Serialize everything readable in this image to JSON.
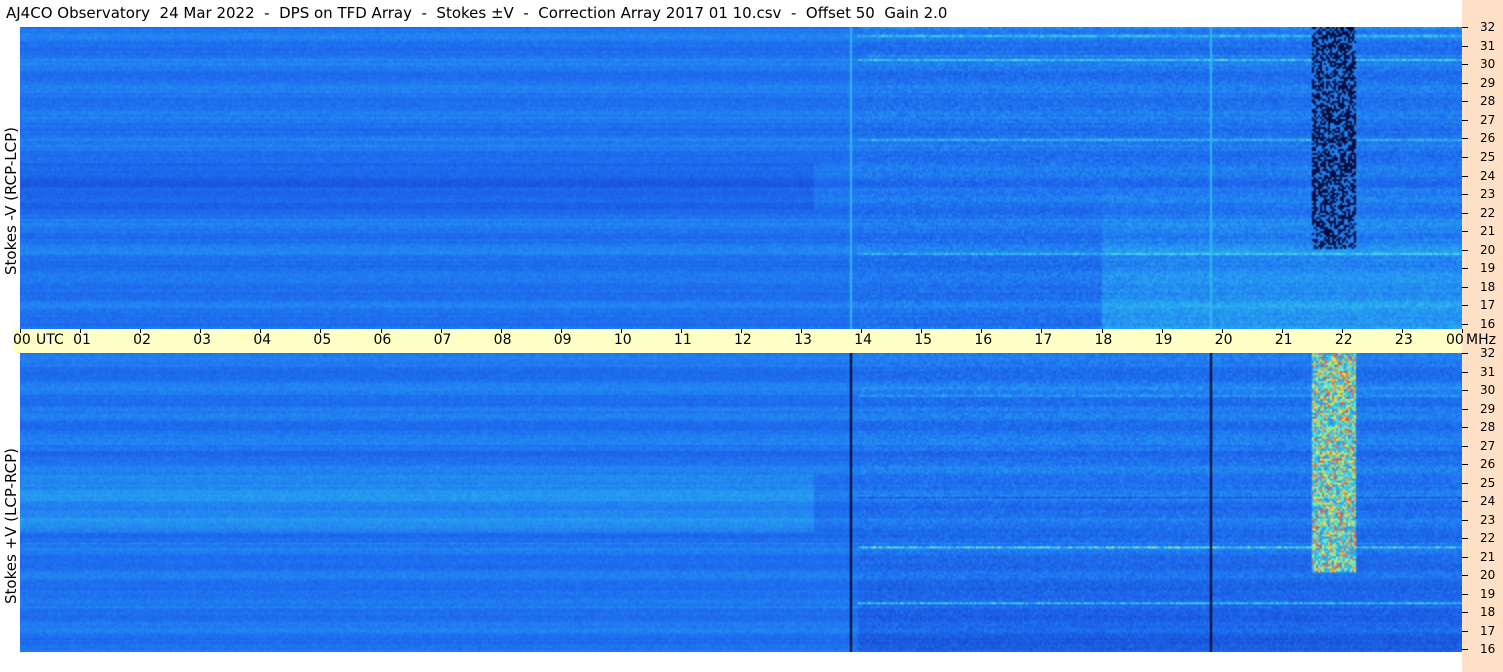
{
  "header": {
    "title": "AJ4CO Observatory  24 Mar 2022  -  DPS on TFD Array  -  Stokes ±V  -  Correction Array 2017 01 10.csv  -  Offset 50  Gain 2.0"
  },
  "panels": {
    "top_ylabel": "Stokes -V (RCP-LCP)",
    "bottom_ylabel": "Stokes +V (LCP-RCP)"
  },
  "colors": {
    "background_blue": "#1e64e6",
    "time_bar": "#ffffc8",
    "freq_bar": "#ffe1c8"
  },
  "chart_data": {
    "type": "heatmap",
    "x_axis": {
      "unit": "UTC",
      "tick_labels": [
        "00",
        "01",
        "02",
        "03",
        "04",
        "05",
        "06",
        "07",
        "08",
        "09",
        "10",
        "11",
        "12",
        "13",
        "14",
        "15",
        "16",
        "17",
        "18",
        "19",
        "20",
        "21",
        "22",
        "23",
        "00"
      ],
      "unit_label": "UTC",
      "range_hours": [
        0,
        24
      ]
    },
    "y_axis": {
      "unit": "MHz",
      "tick_labels": [
        "32",
        "31",
        "30",
        "29",
        "28",
        "27",
        "26",
        "25",
        "24",
        "23",
        "22",
        "21",
        "20",
        "19",
        "18",
        "17",
        "16"
      ],
      "range": [
        16,
        32
      ]
    },
    "freq_unit_label": "MHz",
    "panels": [
      {
        "name": "Stokes -V (RCP-LCP)",
        "vertical_markers_utc": [
          13.8,
          19.8
        ],
        "burst_utc": [
          21.5,
          22.2
        ]
      },
      {
        "name": "Stokes +V (LCP-RCP)",
        "vertical_markers_utc": [
          13.8,
          19.8
        ],
        "burst_utc": [
          21.5,
          22.2
        ]
      }
    ]
  }
}
